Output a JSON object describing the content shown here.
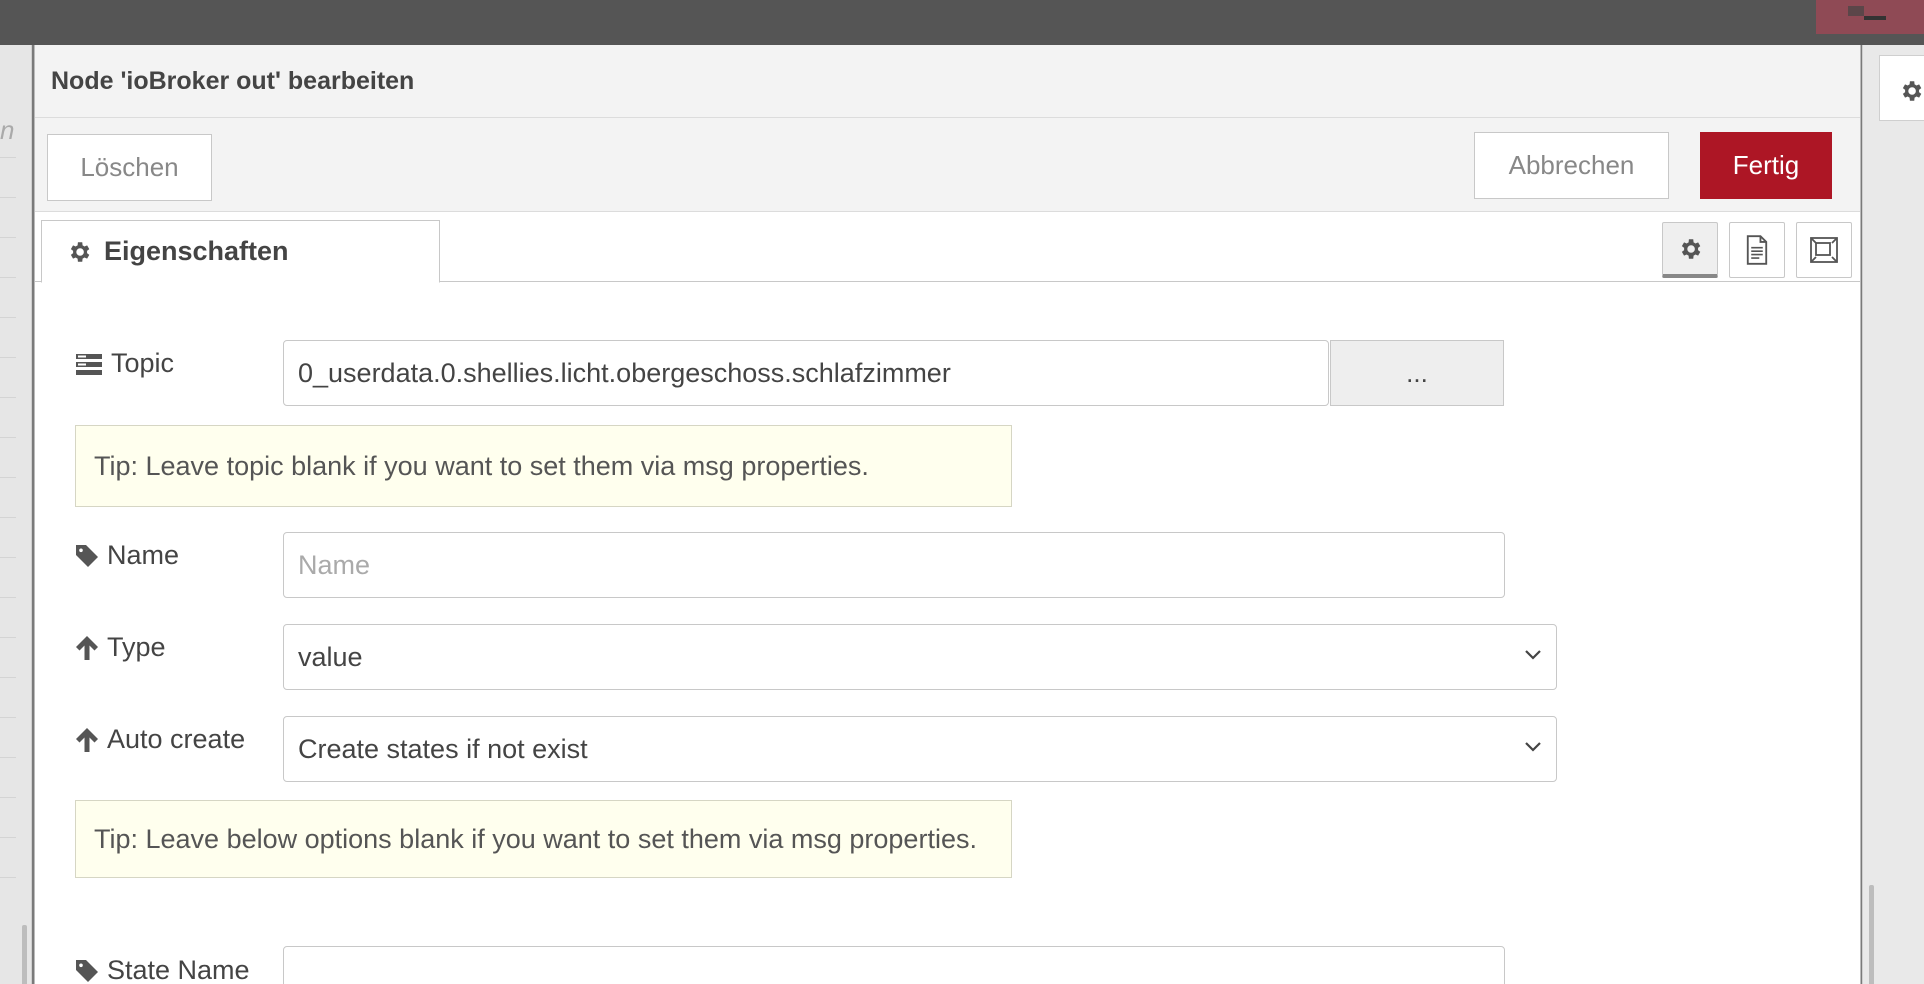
{
  "dialog": {
    "title": "Node 'ioBroker out' bearbeiten",
    "buttons": {
      "delete": "Löschen",
      "cancel": "Abbrechen",
      "done": "Fertig"
    },
    "tabs": {
      "properties": "Eigenschaften"
    }
  },
  "form": {
    "topic": {
      "label": "Topic",
      "value": "0_userdata.0.shellies.licht.obergeschoss.schlafzimmer",
      "picker_label": "..."
    },
    "tip_topic": "Tip: Leave topic blank if you want to set them via msg properties.",
    "name": {
      "label": "Name",
      "placeholder": "Name"
    },
    "type": {
      "label": "Type",
      "selected": "value"
    },
    "auto_create": {
      "label": "Auto create",
      "selected": "Create states if not exist"
    },
    "tip_options": "Tip: Leave below options blank if you want to set them via msg properties.",
    "state_name": {
      "label": "State Name"
    }
  },
  "colors": {
    "accent": "#ad1625",
    "topbar": "#555555",
    "tip_background": "#ffffee"
  },
  "icons": {
    "tab": "gear-icon",
    "side_buttons": [
      "gear-icon",
      "document-icon",
      "expand-icon"
    ],
    "topic": "list-icon",
    "name": "tag-icon",
    "type": "arrow-up-icon",
    "auto_create": "arrow-up-icon",
    "state_name": "tag-icon"
  }
}
